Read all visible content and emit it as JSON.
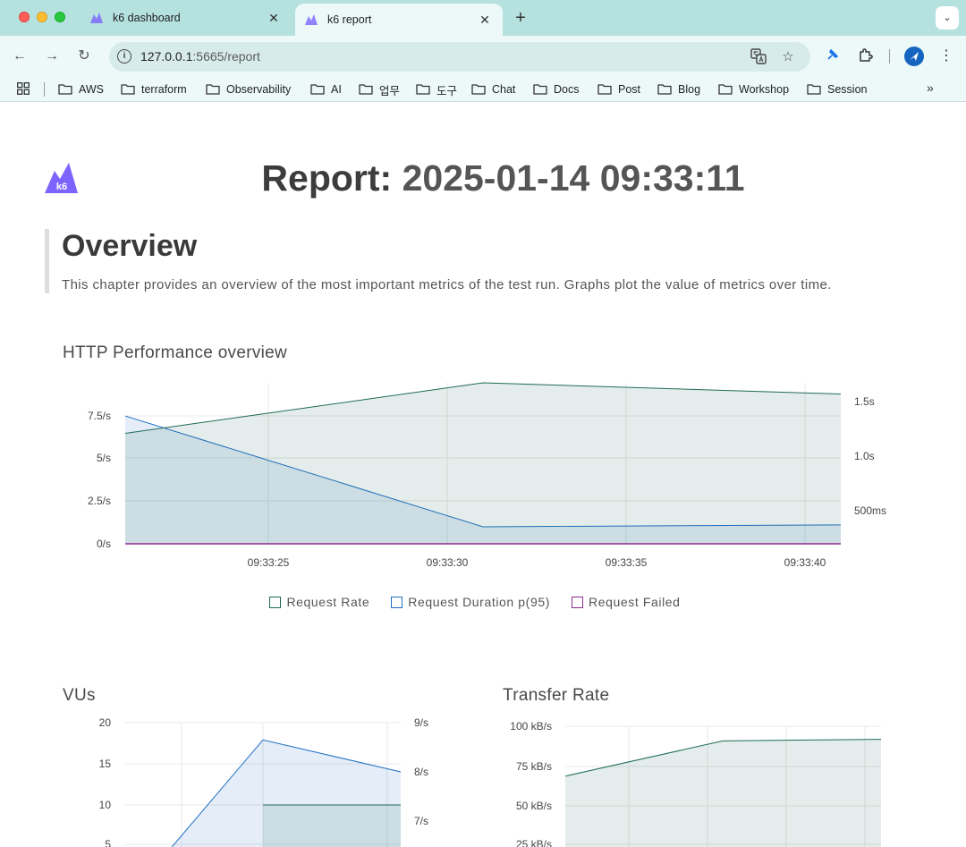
{
  "browser": {
    "tabs": [
      {
        "label": "k6 dashboard",
        "active": false
      },
      {
        "label": "k6 report",
        "active": true
      }
    ],
    "url_host": "127.0.0.1",
    "url_rest": ":5665/report",
    "bookmarks": [
      "AWS",
      "terraform",
      "Observability",
      "AI",
      "업무",
      "도구",
      "Chat",
      "Docs",
      "Post",
      "Blog",
      "Workshop",
      "Session"
    ],
    "colors": {
      "tabbar": "#b5e1df",
      "toolbar": "#ecf9f8"
    }
  },
  "report": {
    "title_prefix": "Report:",
    "title_date": "2025-01-14 09:33:11",
    "logo_text": "k6",
    "overview_heading": "Overview",
    "overview_text": "This chapter provides an overview of the most important metrics of the test run. Graphs plot the value of metrics over time."
  },
  "chart_data": [
    {
      "type": "line",
      "title": "HTTP Performance overview",
      "xticks": [
        "09:33:25",
        "09:33:30",
        "09:33:35",
        "09:33:40"
      ],
      "y_left_ticks": [
        "0/s",
        "2.5/s",
        "5/s",
        "7.5/s"
      ],
      "y_right_ticks": [
        "500ms",
        "1.0s",
        "1.5s"
      ],
      "y_left_lim": [
        0,
        8.6
      ],
      "y_right_lim": [
        0,
        1.7
      ],
      "x": [
        "09:33:21",
        "09:33:31",
        "09:33:41"
      ],
      "series": [
        {
          "name": "Request Rate",
          "axis": "left",
          "values": [
            5.9,
            8.6,
            8.0
          ],
          "color": "#1e6b5a"
        },
        {
          "name": "Request Duration p(95)",
          "axis": "right",
          "values": [
            1.35,
            0.18,
            0.2
          ],
          "color": "#1f6fc5"
        },
        {
          "name": "Request Failed",
          "axis": "left",
          "values": [
            0,
            0,
            0
          ],
          "color": "#8e2c8e"
        }
      ],
      "legend_position": "bottom",
      "grid": true
    },
    {
      "type": "line",
      "title": "VUs",
      "y_left_ticks": [
        "5",
        "10",
        "15",
        "20"
      ],
      "y_right_ticks": [
        "7/s",
        "8/s",
        "9/s"
      ],
      "series": [
        {
          "axis": "right",
          "values": [
            6.0,
            8.65,
            8.0
          ],
          "color": "#1f6fc5"
        },
        {
          "axis": "left",
          "values": [
            10,
            10
          ],
          "color": "#1e6b5a"
        }
      ],
      "grid": true
    },
    {
      "type": "area",
      "title": "Transfer Rate",
      "y_left_ticks": [
        "25 kB/s",
        "50 kB/s",
        "75 kB/s",
        "100 kB/s"
      ],
      "series": [
        {
          "values": [
            69,
            91,
            92
          ],
          "color": "#1e6b5a"
        }
      ],
      "grid": true
    }
  ]
}
